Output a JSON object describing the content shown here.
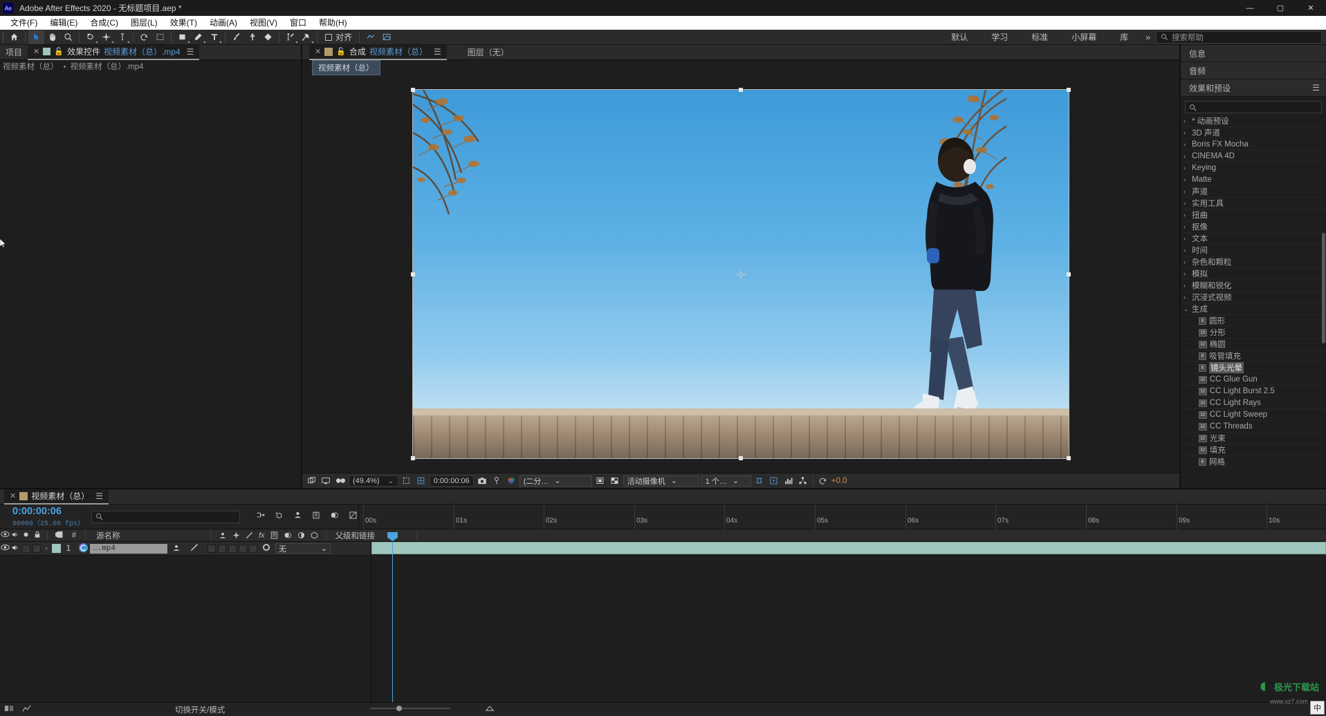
{
  "window": {
    "app_badge": "Ae",
    "title": "Adobe After Effects 2020 - 无标题项目.aep *",
    "minimize": "—",
    "maximize": "▢",
    "close": "✕"
  },
  "menu": [
    "文件(F)",
    "编辑(E)",
    "合成(C)",
    "图层(L)",
    "效果(T)",
    "动画(A)",
    "视图(V)",
    "窗口",
    "帮助(H)"
  ],
  "toolbar": {
    "align_label": "对齐",
    "workspaces": [
      "默认",
      "学习",
      "标准",
      "小屏幕",
      "库"
    ],
    "more": "»",
    "search_placeholder": "搜索帮助"
  },
  "project_panel": {
    "tab_project": "项目",
    "close_x": "✕",
    "tab_effect_controls": "效果控件",
    "tab_effect_file": "视频素材（总）.mp4",
    "menu_glyph": "☰",
    "breadcrumb_root": "视频素材（总）",
    "breadcrumb_leaf": "视频素材（总）.mp4"
  },
  "comp_panel": {
    "close_x": "✕",
    "tab_label": "合成",
    "tab_name": "视频素材（总）",
    "menu_glyph": "☰",
    "layer_label": "图层（无）",
    "comp_chip": "视频素材（总）",
    "bottom_bar": {
      "zoom": "(49.4%)",
      "time": "0:00:00:06",
      "resolution": "(二分…",
      "camera": "活动摄像机",
      "views": "1 个…",
      "exposure": "+0.0"
    }
  },
  "right_panel": {
    "tab_info": "信息",
    "tab_audio": "音频",
    "tab_effects": "效果和预设",
    "menu_glyph": "☰",
    "search_placeholder": "",
    "categories": [
      {
        "label": "* 动画预设",
        "open": false
      },
      {
        "label": "3D 声道",
        "open": false
      },
      {
        "label": "Boris FX Mocha",
        "open": false
      },
      {
        "label": "CINEMA 4D",
        "open": false
      },
      {
        "label": "Keying",
        "open": false
      },
      {
        "label": "Matte",
        "open": false
      },
      {
        "label": "声道",
        "open": false
      },
      {
        "label": "实用工具",
        "open": false
      },
      {
        "label": "扭曲",
        "open": false
      },
      {
        "label": "抠像",
        "open": false
      },
      {
        "label": "文本",
        "open": false
      },
      {
        "label": "时间",
        "open": false
      },
      {
        "label": "杂色和颗粒",
        "open": false
      },
      {
        "label": "模拟",
        "open": false
      },
      {
        "label": "模糊和锐化",
        "open": false
      },
      {
        "label": "沉浸式视频",
        "open": false
      },
      {
        "label": "生成",
        "open": true
      }
    ],
    "generate_effects": [
      {
        "bits": "8",
        "label": "圆形",
        "selected": false
      },
      {
        "bits": "16",
        "label": "分形",
        "selected": false
      },
      {
        "bits": "32",
        "label": "椭圆",
        "selected": false
      },
      {
        "bits": "8",
        "label": "吸管填充",
        "selected": false
      },
      {
        "bits": "8",
        "label": "镜头光晕",
        "selected": true
      },
      {
        "bits": "32",
        "label": "CC Glue Gun",
        "selected": false
      },
      {
        "bits": "32",
        "label": "CC Light Burst 2.5",
        "selected": false
      },
      {
        "bits": "32",
        "label": "CC Light Rays",
        "selected": false
      },
      {
        "bits": "32",
        "label": "CC Light Sweep",
        "selected": false
      },
      {
        "bits": "32",
        "label": "CC Threads",
        "selected": false
      },
      {
        "bits": "32",
        "label": "光束",
        "selected": false
      },
      {
        "bits": "32",
        "label": "填充",
        "selected": false
      },
      {
        "bits": "8",
        "label": "网格",
        "selected": false
      }
    ]
  },
  "timeline": {
    "close_x": "✕",
    "tab_name": "视频素材（总）",
    "menu_glyph": "☰",
    "current_time": "0:00:00:06",
    "frame_info": "00006（25.00 fps）",
    "search_placeholder": "",
    "columns": {
      "source_name": "源名称",
      "parent_link": "父级和链接",
      "hash": "#"
    },
    "layers": [
      {
        "index": "1",
        "name": "….mp4",
        "parent": "无",
        "parent_caret": "⌄"
      }
    ],
    "ruler_ticks": [
      "00s",
      "01s",
      "02s",
      "03s",
      "04s",
      "05s",
      "06s",
      "07s",
      "08s",
      "09s",
      "10s"
    ],
    "footer_label": "切换开关/模式"
  },
  "watermark": {
    "line1": "极光下载站",
    "line2": "www.xz7.com"
  },
  "ime_badge": "中",
  "colors": {
    "accent_blue": "#4aa3e0",
    "link_blue": "#5b9bd5",
    "panel_bg": "#1e1e1e",
    "tab_bg": "#2b2b2b",
    "clip_green": "#9fc6bc"
  }
}
